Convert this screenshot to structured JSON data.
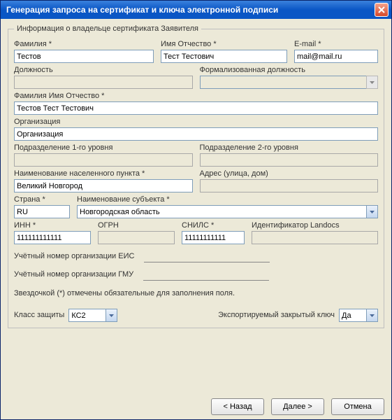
{
  "window": {
    "title": "Генерация запроса на сертификат и ключа электронной подписи"
  },
  "group": {
    "legend": "Информация о владельце сертификата Заявителя"
  },
  "labels": {
    "surname": "Фамилия *",
    "name_patr": "Имя Отчество *",
    "email": "E-mail *",
    "position": "Должность",
    "formal_position": "Формализованная должность",
    "fio": "Фамилия Имя Отчество *",
    "org": "Организация",
    "dept1": "Подразделение 1-го уровня",
    "dept2": "Подразделение 2-го уровня",
    "locality": "Наименование населенного пункта *",
    "address": "Адрес (улица, дом)",
    "country": "Страна *",
    "subject": "Наименование субъекта *",
    "inn": "ИНН *",
    "ogrn": "ОГРН",
    "snils": "СНИЛС *",
    "landocs": "Идентификатор Landocs",
    "eis": "Учётный номер организации ЕИС",
    "gmu": "Учётный номер организации ГМУ",
    "note": "Звездочкой (*) отмечены обязательные для заполнения поля.",
    "protection": "Класс защиты",
    "exportable": "Экспортируемый закрытый ключ"
  },
  "values": {
    "surname": "Тестов",
    "name_patr": "Тест Тестович",
    "email": "mail@mail.ru",
    "position": "",
    "formal_position": "",
    "fio": "Тестов Тест Тестович",
    "org": "Организация",
    "dept1": "",
    "dept2": "",
    "locality": "Великий Новгород",
    "address": "",
    "country": "RU",
    "subject": "Новгородская область",
    "inn": "111111111111",
    "ogrn": "",
    "snils": "11111111111",
    "landocs": "",
    "eis": "",
    "gmu": "",
    "protection": "КС2",
    "exportable": "Да"
  },
  "buttons": {
    "back": "< Назад",
    "next": "Далее >",
    "cancel": "Отмена"
  }
}
